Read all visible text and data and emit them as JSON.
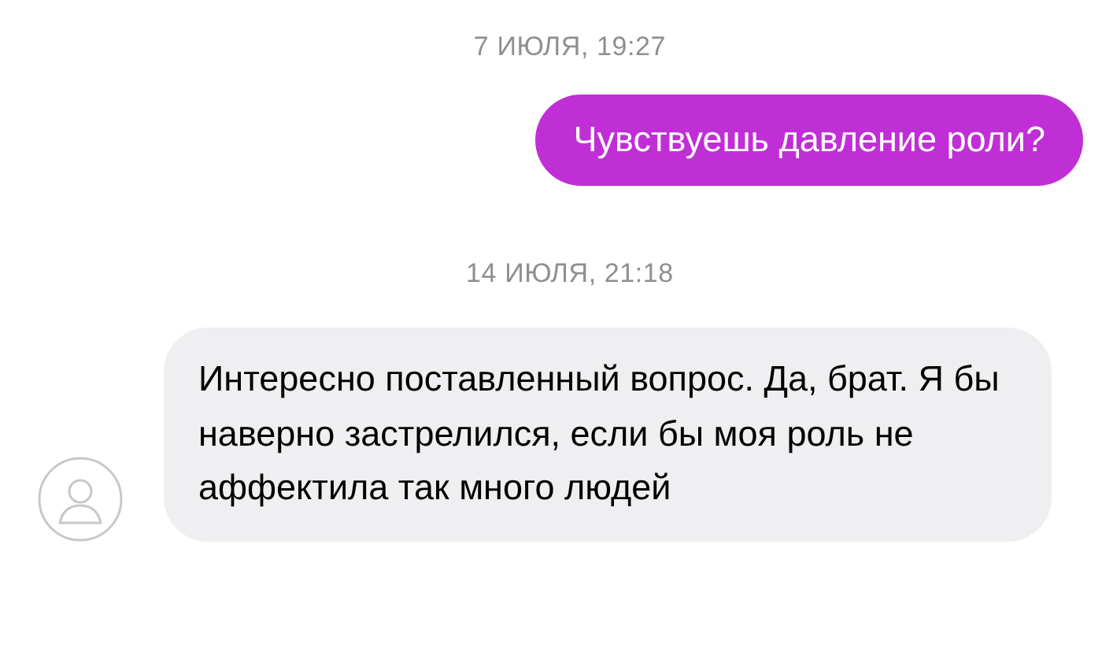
{
  "messages": [
    {
      "kind": "date",
      "text": "7 ИЮЛЯ, 19:27"
    },
    {
      "kind": "outgoing",
      "text": "Чувствуешь давление роли?"
    },
    {
      "kind": "date",
      "text": "14 ИЮЛЯ, 21:18"
    },
    {
      "kind": "incoming",
      "text": "Интересно поставленный вопрос. Да, брат. Я бы наверно застрелился, если бы моя роль не аффектила так много людей"
    }
  ]
}
